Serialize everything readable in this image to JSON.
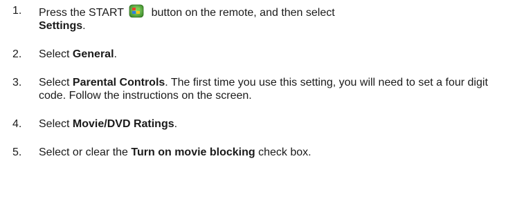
{
  "steps": [
    {
      "number": "1.",
      "text_before_icon": "Press the START",
      "icon": "windows-start-icon",
      "text_after_icon": "button on the remote, and then select",
      "bold": "Settings",
      "text_after_bold": "."
    },
    {
      "number": "2.",
      "text_before": "Select",
      "bold": "General",
      "text_after": "."
    },
    {
      "number": "3.",
      "text_before": "Select",
      "bold": "Parental Controls",
      "text_after": ". The first time you use this setting, you will need to set a four digit code. Follow the instructions on the screen."
    },
    {
      "number": "4.",
      "text_before": "Select",
      "bold": "Movie/DVD Ratings",
      "text_after": "."
    },
    {
      "number": "5.",
      "text_before": "Select or clear the",
      "bold": "Turn on movie blocking",
      "text_after": "check box."
    }
  ]
}
